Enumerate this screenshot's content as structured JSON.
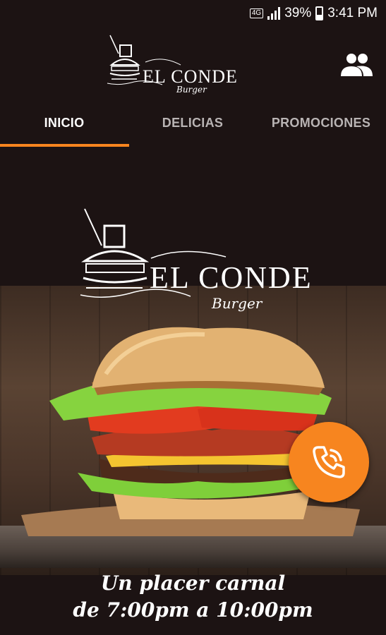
{
  "status_bar": {
    "network": "4G",
    "battery": "39%",
    "time": "3:41 PM"
  },
  "app_bar": {
    "logo_text": "EL CONDE",
    "logo_subtext": "Burger",
    "account_icon": "people-icon"
  },
  "tabs": [
    {
      "label": "INICIO",
      "active": true
    },
    {
      "label": "DELICIAS",
      "active": false
    },
    {
      "label": "PROMOCIONES",
      "active": false
    }
  ],
  "hero": {
    "logo_text": "EL CONDE",
    "logo_subtext": "Burger",
    "tagline_line1": "Un placer carnal",
    "tagline_line2": "de 7:00pm a 10:00pm"
  },
  "fab": {
    "icon": "phone-call-icon"
  },
  "colors": {
    "accent": "#f7851f",
    "background": "#1c1313"
  }
}
